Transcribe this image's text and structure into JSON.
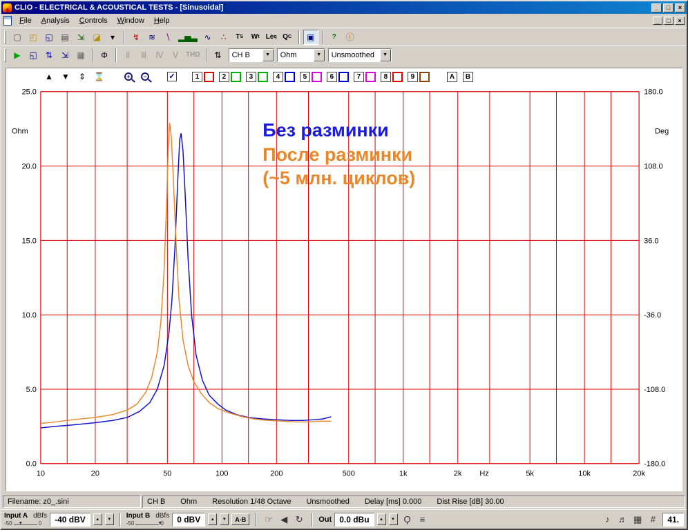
{
  "window": {
    "title": "CLIO - ELECTRICAL & ACOUSTICAL TESTS - [Sinusoidal]",
    "controls": {
      "minimize": "_",
      "maximize": "□",
      "close": "×"
    }
  },
  "menu": {
    "items": [
      "File",
      "Analysis",
      "Controls",
      "Window",
      "Help"
    ]
  },
  "toolbar1": {
    "icons": [
      {
        "name": "new-document-icon",
        "glyph": "▢",
        "color": "#505050"
      },
      {
        "name": "open-file-icon",
        "glyph": "◰",
        "color": "#c09000"
      },
      {
        "name": "save-file-icon",
        "glyph": "◱",
        "color": "#000080"
      },
      {
        "name": "print-icon",
        "glyph": "▤",
        "color": "#404040"
      },
      {
        "name": "export-icon",
        "glyph": "⇲",
        "color": "#006000"
      },
      {
        "name": "eraser-icon",
        "glyph": "◪",
        "color": "#b09000"
      },
      {
        "name": "eraser-dropdown-icon",
        "glyph": "▾",
        "color": "#000"
      },
      {
        "sep": true
      },
      {
        "name": "mls-analysis-icon",
        "glyph": "↯",
        "color": "#b00000"
      },
      {
        "name": "waterfall-icon",
        "glyph": "≋",
        "color": "#000080"
      },
      {
        "name": "decay-icon",
        "glyph": "∖",
        "color": "#800080"
      },
      {
        "name": "rta-bars-icon",
        "glyph": "▂▅▃",
        "color": "#006000"
      },
      {
        "name": "sinusoidal-icon",
        "glyph": "∿",
        "color": "#000080"
      },
      {
        "name": "scatter-icon",
        "glyph": "∴",
        "color": "#b00000"
      },
      {
        "name": "ts-parameters-icon",
        "glyph": "T<sub>S</sub>",
        "color": "#000",
        "txt": true
      },
      {
        "name": "wt-analysis-icon",
        "glyph": "W<sub>t</sub>",
        "color": "#000",
        "txt": true
      },
      {
        "name": "leq-analysis-icon",
        "glyph": "Le<sub>q</sub>",
        "color": "#000",
        "txt": true
      },
      {
        "name": "qc-icon",
        "glyph": "Q<sub>C</sub>",
        "color": "#000",
        "txt": true
      },
      {
        "sep": true
      },
      {
        "name": "scope-window-icon",
        "glyph": "▣",
        "color": "#000080",
        "selected": true
      },
      {
        "sep": true
      },
      {
        "name": "help-icon",
        "glyph": "?",
        "color": "#007000",
        "txt": true
      },
      {
        "name": "about-icon",
        "glyph": "ⓘ",
        "color": "#b06000"
      }
    ]
  },
  "toolbar2": {
    "dropdown_glyph": "▼",
    "icons": [
      {
        "name": "start-measurement-button",
        "glyph": "▶",
        "color": "#00a000"
      },
      {
        "name": "save-measurement-icon",
        "glyph": "◱",
        "color": "#000080"
      },
      {
        "name": "autoscale-icon",
        "glyph": "⇅",
        "color": "#0000c0"
      },
      {
        "name": "fit-scale-icon",
        "glyph": "⇲",
        "color": "#000080"
      },
      {
        "name": "settings-table-icon",
        "glyph": "▦",
        "color": "#606060"
      },
      {
        "sep": true
      },
      {
        "name": "phase-button",
        "glyph": "Φ",
        "color": "#000000"
      },
      {
        "sep": true
      },
      {
        "name": "harmonic-2nd-button",
        "glyph": "Ⅱ",
        "disabled": true
      },
      {
        "name": "harmonic-3rd-button",
        "glyph": "Ⅲ",
        "disabled": true
      },
      {
        "name": "harmonic-4th-button",
        "glyph": "Ⅳ",
        "disabled": true
      },
      {
        "name": "harmonic-5th-button",
        "glyph": "Ⅴ",
        "disabled": true
      },
      {
        "name": "thd-button",
        "glyph": "THD",
        "disabled": true,
        "txt": true
      },
      {
        "sep": true
      },
      {
        "name": "scale-spinner",
        "glyph": "⇅",
        "color": "#000"
      }
    ],
    "combos": [
      {
        "name": "channel-select",
        "value": "CH B"
      },
      {
        "name": "unit-select",
        "value": "Ohm"
      },
      {
        "name": "smoothing-select",
        "value": "Unsmoothed"
      }
    ]
  },
  "chart_toolbar": {
    "icons": [
      {
        "name": "shift-up-icon",
        "glyph": "▲"
      },
      {
        "name": "shift-down-icon",
        "glyph": "▼"
      },
      {
        "name": "expand-scale-icon",
        "glyph": "⇕"
      },
      {
        "name": "compress-scale-icon",
        "glyph": "⌛"
      }
    ],
    "zoom_in": "+",
    "zoom_out": "−",
    "marker_check": "✓",
    "curves": [
      {
        "label": "1",
        "color": "#e00000"
      },
      {
        "label": "2",
        "color": "#00b000"
      },
      {
        "label": "3",
        "color": "#00b000"
      },
      {
        "label": "4",
        "color": "#0000d0"
      },
      {
        "label": "5",
        "color": "#e000e0"
      },
      {
        "label": "6",
        "color": "#0000d0"
      },
      {
        "label": "7",
        "color": "#e000e0"
      },
      {
        "label": "8",
        "color": "#e00000"
      },
      {
        "label": "9",
        "color": "#904000"
      }
    ],
    "overlays": [
      "A",
      "B"
    ]
  },
  "chart_data": {
    "type": "line",
    "x_axis": {
      "unit": "Hz",
      "min": 10,
      "max": 20000,
      "scale": "log",
      "unit_pos": 2800,
      "ticks": [
        {
          "f": 10,
          "label": "10"
        },
        {
          "f": 20,
          "label": "20"
        },
        {
          "f": 50,
          "label": "50"
        },
        {
          "f": 100,
          "label": "100"
        },
        {
          "f": 200,
          "label": "200"
        },
        {
          "f": 500,
          "label": "500"
        },
        {
          "f": 1000,
          "label": "1k"
        },
        {
          "f": 2000,
          "label": "2k"
        },
        {
          "f": 5000,
          "label": "5k"
        },
        {
          "f": 10000,
          "label": "10k"
        },
        {
          "f": 20000,
          "label": "20k"
        }
      ],
      "grid_freqs": [
        10,
        14,
        20,
        30,
        50,
        70,
        100,
        140,
        200,
        300,
        500,
        700,
        1000,
        1400,
        2000,
        3000,
        5000,
        7000,
        10000,
        14000,
        20000
      ]
    },
    "y_left": {
      "label": "Ohm",
      "min": 0,
      "max": 25,
      "ticks": [
        {
          "v": 25,
          "label": "25.0"
        },
        {
          "v": 20,
          "label": "20.0"
        },
        {
          "v": 15,
          "label": "15.0"
        },
        {
          "v": 10,
          "label": "10.0"
        },
        {
          "v": 5,
          "label": "5.0"
        },
        {
          "v": 0,
          "label": "0.0"
        }
      ]
    },
    "y_right": {
      "label": "Deg",
      "ticks": [
        "180.0",
        "108.0",
        "36.0",
        "-36.0",
        "-108.0",
        "-180.0"
      ]
    },
    "grid_color": "#dd0000",
    "series": [
      {
        "name": "Без разминки",
        "color": "#1212cc",
        "points": [
          [
            10,
            2.4
          ],
          [
            12,
            2.5
          ],
          [
            15,
            2.6
          ],
          [
            20,
            2.75
          ],
          [
            25,
            2.9
          ],
          [
            30,
            3.1
          ],
          [
            35,
            3.5
          ],
          [
            40,
            4.1
          ],
          [
            44,
            5.0
          ],
          [
            48,
            6.6
          ],
          [
            51,
            8.8
          ],
          [
            53,
            11.0
          ],
          [
            55,
            14.5
          ],
          [
            57,
            19.0
          ],
          [
            58.5,
            21.8
          ],
          [
            59.5,
            22.2
          ],
          [
            61,
            21.0
          ],
          [
            63,
            17.5
          ],
          [
            65,
            13.8
          ],
          [
            68,
            10.0
          ],
          [
            72,
            7.3
          ],
          [
            78,
            5.6
          ],
          [
            85,
            4.6
          ],
          [
            95,
            4.0
          ],
          [
            105,
            3.6
          ],
          [
            120,
            3.3
          ],
          [
            140,
            3.1
          ],
          [
            170,
            3.0
          ],
          [
            200,
            2.95
          ],
          [
            240,
            2.9
          ],
          [
            280,
            2.9
          ],
          [
            320,
            2.95
          ],
          [
            360,
            3.0
          ],
          [
            400,
            3.15
          ]
        ]
      },
      {
        "name": "После разминки (~5 млн. циклов)",
        "color": "#e8882b",
        "points": [
          [
            10,
            2.7
          ],
          [
            12,
            2.8
          ],
          [
            15,
            2.95
          ],
          [
            20,
            3.1
          ],
          [
            25,
            3.3
          ],
          [
            30,
            3.6
          ],
          [
            34,
            4.0
          ],
          [
            38,
            4.8
          ],
          [
            41,
            5.8
          ],
          [
            44,
            7.5
          ],
          [
            46,
            9.5
          ],
          [
            48,
            13.0
          ],
          [
            49.5,
            17.5
          ],
          [
            50.5,
            21.0
          ],
          [
            51.5,
            22.9
          ],
          [
            52.5,
            22.0
          ],
          [
            54,
            19.0
          ],
          [
            56,
            14.5
          ],
          [
            58,
            11.0
          ],
          [
            61,
            8.3
          ],
          [
            65,
            6.6
          ],
          [
            70,
            5.5
          ],
          [
            77,
            4.7
          ],
          [
            85,
            4.1
          ],
          [
            95,
            3.7
          ],
          [
            110,
            3.4
          ],
          [
            130,
            3.15
          ],
          [
            150,
            3.0
          ],
          [
            180,
            2.9
          ],
          [
            220,
            2.85
          ],
          [
            260,
            2.8
          ],
          [
            300,
            2.8
          ],
          [
            350,
            2.85
          ],
          [
            400,
            2.85
          ]
        ]
      }
    ],
    "annotations": [
      {
        "text": "Без разминки",
        "color": "#1a1ae0",
        "x": 372,
        "y": 76
      },
      {
        "text": "После разминки",
        "color": "#e8882b",
        "x": 372,
        "y": 112
      },
      {
        "text": "(~5 млн. циклов)",
        "color": "#e8882b",
        "x": 372,
        "y": 147
      }
    ]
  },
  "statusbar": {
    "filename": "Filename: z0_.sini",
    "segments": [
      "CH B",
      "Ohm",
      "Resolution 1/48 Octave",
      "Unsmoothed",
      "Delay [ms] 0.000",
      "Dist Rise [dB] 30.00"
    ]
  },
  "bottom_bar": {
    "spinner_up": "▴",
    "spinner_down": "▾",
    "caret_glyph": "▼",
    "input_a": {
      "label": "Input A",
      "unit": "dBfs",
      "scale_min": "-50",
      "scale_max": "0",
      "value": "-40 dBV",
      "caret_pct": 20
    },
    "input_b": {
      "label": "Input B",
      "unit": "dBfs",
      "scale_min": "-50",
      "scale_max": "0",
      "value": "0 dBV",
      "caret_pct": 94
    },
    "ab_label": "A-B",
    "out": {
      "label": "Out",
      "value": "0.0 dBu"
    },
    "right_value": "41.",
    "icons_mid": [
      {
        "name": "monitor-hand-icon",
        "glyph": "☞"
      },
      {
        "name": "speaker-icon",
        "glyph": "◀"
      },
      {
        "name": "loop-icon",
        "glyph": "↻"
      }
    ],
    "icons_right": [
      {
        "name": "mic-icon",
        "glyph": "Ϙ"
      },
      {
        "name": "levels-icon",
        "glyph": "≡"
      }
    ],
    "icons_far_right": [
      {
        "name": "meter-a-icon",
        "glyph": "♪"
      },
      {
        "name": "meter-b-icon",
        "glyph": "♬"
      },
      {
        "name": "matrix-icon",
        "glyph": "▦"
      },
      {
        "name": "keypad-icon",
        "glyph": "#"
      }
    ]
  }
}
